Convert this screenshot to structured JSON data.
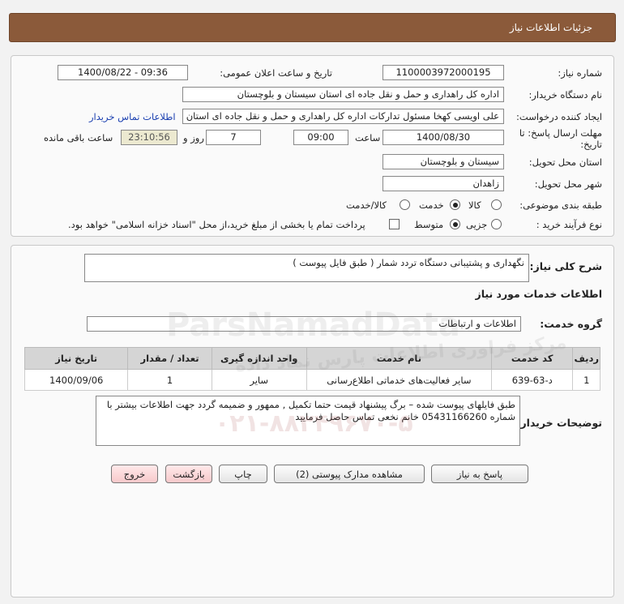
{
  "header": {
    "title": "جزئیات اطلاعات نیاز"
  },
  "details": {
    "need_number_label": "شماره نیاز:",
    "need_number": "1100003972000195",
    "announce_datetime_label": "تاریخ و ساعت اعلان عمومی:",
    "announce_datetime": "1400/08/22 - 09:36",
    "buyer_org_label": "نام دستگاه خریدار:",
    "buyer_org": "اداره کل راهداری و حمل و نقل جاده ای استان سیستان و بلوچستان",
    "requester_label": "ایجاد کننده درخواست:",
    "requester": "علی اویسی کهخا مسئول تدارکات اداره کل راهداری و حمل و نقل جاده ای استان",
    "buyer_contact_link": "اطلاعات تماس خریدار",
    "deadline_label_line1": "مهلت ارسال پاسخ: تا",
    "deadline_label_line2": "تاریخ:",
    "deadline_date": "1400/08/30",
    "time_label": "ساعت",
    "deadline_time": "09:00",
    "days_value": "7",
    "days_label": "روز و",
    "remaining_time": "23:10:56",
    "remaining_label": "ساعت باقی مانده",
    "province_label": "استان محل تحویل:",
    "province": "سیستان و بلوچستان",
    "city_label": "شهر محل تحویل:",
    "city": "زاهدان",
    "category_label": "طبقه بندی موضوعی:",
    "category_options": [
      "کالا",
      "خدمت",
      "کالا/خدمت"
    ],
    "category_selected": "خدمت",
    "purchase_type_label": "نوع فرآیند خرید :",
    "purchase_type_options": [
      "جزیی",
      "متوسط"
    ],
    "purchase_type_selected": "متوسط",
    "payment_note": "پرداخت تمام یا بخشی از مبلغ خرید،از محل \"اسناد خزانه اسلامی\" خواهد بود."
  },
  "description": {
    "general_label": "شرح کلی نیاز:",
    "general_text": "نگهداری و پشتیبانی دستگاه تردد شمار ( طبق فایل پیوست )",
    "services_heading": "اطلاعات خدمات مورد نیاز",
    "service_group_label": "گروه خدمت:",
    "service_group": "اطلاعات و ارتباطات"
  },
  "services_table": {
    "headers": [
      "ردیف",
      "کد خدمت",
      "نام خدمت",
      "واحد اندازه گیری",
      "تعداد / مقدار",
      "تاریخ نیاز"
    ],
    "rows": [
      [
        "1",
        "د-63-639",
        "سایر فعالیت‌های خدماتی اطلاع‌رسانی",
        "سایر",
        "1",
        "1400/09/06"
      ]
    ]
  },
  "buyer_notes": {
    "label": "توضیحات خریدار:",
    "text": "طبق فایلهای پیوست شده – برگ پیشنهاد قیمت حتما تکمیل , ممهور و ضمیمه گردد جهت اطلاعات بیشتر با شماره 05431166260 خانم نخعی  تماس حاصل فرمایید"
  },
  "buttons": {
    "reply": "پاسخ به نیاز",
    "attachments": "مشاهده مدارک پیوستی (2)",
    "print": "چاپ",
    "back": "بازگشت",
    "exit": "خروج"
  },
  "watermark": {
    "brand": "ParsNamadData",
    "persian": "مرکز فراوری اطلاعات پارس نماد داده",
    "phone": "۰۲۱-۸۸۳۴۹۶۷۰-۵"
  }
}
